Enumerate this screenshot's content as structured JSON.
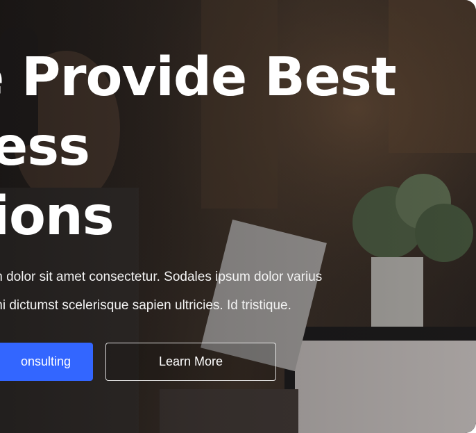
{
  "hero": {
    "headline_line_1": "e Provide Best",
    "headline_line_2": "siness",
    "headline_line_3": "utions",
    "paragraph_line_1": "m dolor sit amet consectetur. Sodales ipsum dolor varius",
    "paragraph_line_2": "mi dictumst scelerisque sapien ultricies. Id tristique.",
    "primary_button_label": "onsulting",
    "secondary_button_label": "Learn More"
  },
  "colors": {
    "primary": "#3366ff",
    "text": "#ffffff"
  }
}
